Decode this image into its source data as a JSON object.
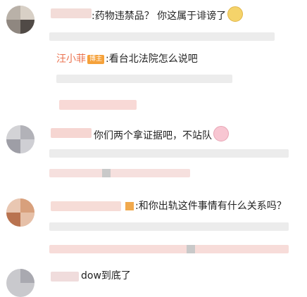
{
  "comments": [
    {
      "text": ":药物违禁品？ 你这属于诽谤了",
      "emoji": "face-emoji"
    },
    {
      "reply_name": "汪小菲",
      "reply_badge": "博主",
      "reply_text": ":看台北法院怎么说吧"
    },
    {
      "text": "你们两个拿证据吧，不站队",
      "emoji": "bunny-emoji"
    },
    {
      "text": ":和你出轨这件事情有什么关系吗？"
    },
    {
      "text": "dow到底了"
    }
  ],
  "colors": {
    "reply_name": "#eb7350",
    "badge": "#f5a13a",
    "blur_pink": "#f9d8d5",
    "blur_gray": "#e8e8e8"
  }
}
